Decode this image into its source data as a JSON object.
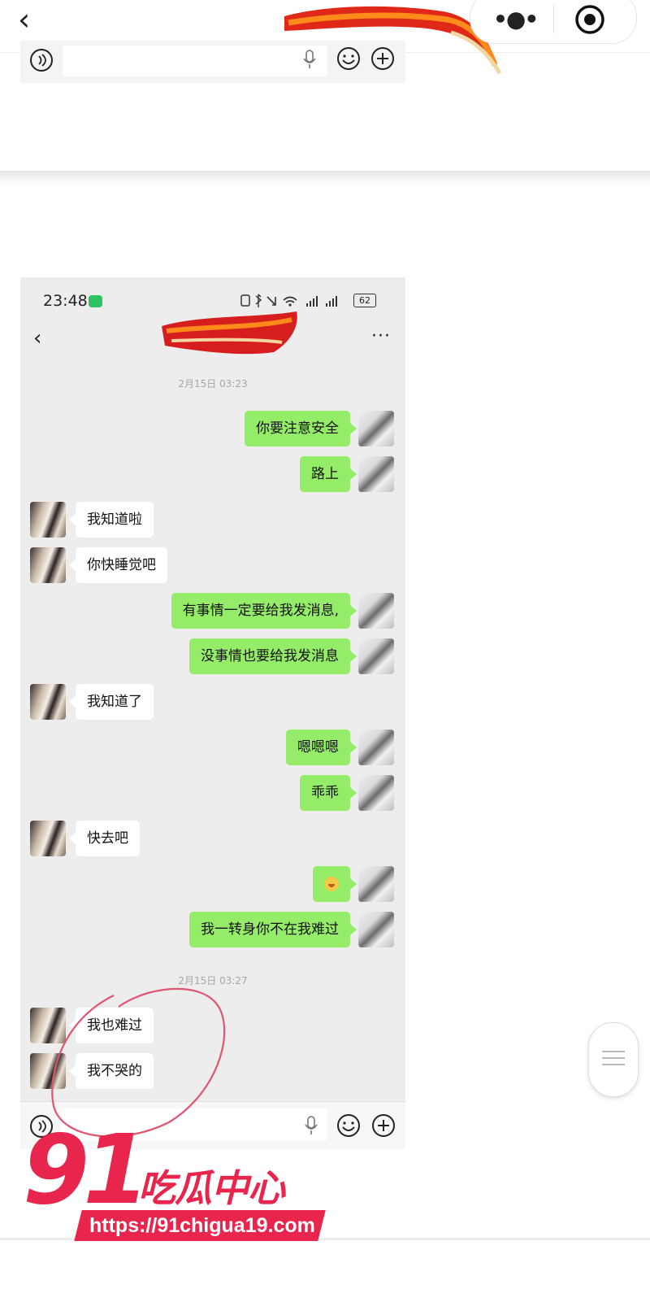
{
  "browser": {
    "back_icon": "chevron-left-icon",
    "more_icon": "more-dots-icon",
    "target_icon": "target-icon"
  },
  "chat": {
    "status_time": "23:48",
    "battery": "62",
    "timestamps": [
      "2月15日 03:23",
      "2月15日 03:27"
    ],
    "messages": [
      {
        "side": "me",
        "text": "你要注意安全"
      },
      {
        "side": "me",
        "text": "路上"
      },
      {
        "side": "other",
        "text": "我知道啦"
      },
      {
        "side": "other",
        "text": "你快睡觉吧"
      },
      {
        "side": "me",
        "text": "有事情一定要给我发消息,"
      },
      {
        "side": "me",
        "text": "没事情也要给我发消息"
      },
      {
        "side": "other",
        "text": "我知道了"
      },
      {
        "side": "me",
        "text": "嗯嗯嗯"
      },
      {
        "side": "me",
        "text": "乖乖"
      },
      {
        "side": "other",
        "text": "快去吧"
      },
      {
        "side": "me",
        "text": "",
        "emoji": "grin-emoji"
      },
      {
        "side": "me",
        "text": "我一转身你不在我难过"
      },
      {
        "side": "other",
        "text": "我也难过"
      },
      {
        "side": "other",
        "text": "我不哭的"
      }
    ],
    "input_icons": [
      "voice-icon",
      "mic-icon",
      "emoji-icon",
      "plus-icon"
    ]
  },
  "watermark": {
    "number": "91",
    "name": "吃瓜中心",
    "url": "https://91chigua19.com"
  },
  "colors": {
    "bubble_me": "#95ec69",
    "bubble_other": "#ffffff",
    "chat_bg": "#ededed",
    "watermark": "#e8264d",
    "annotation_circle": "#e05570"
  }
}
